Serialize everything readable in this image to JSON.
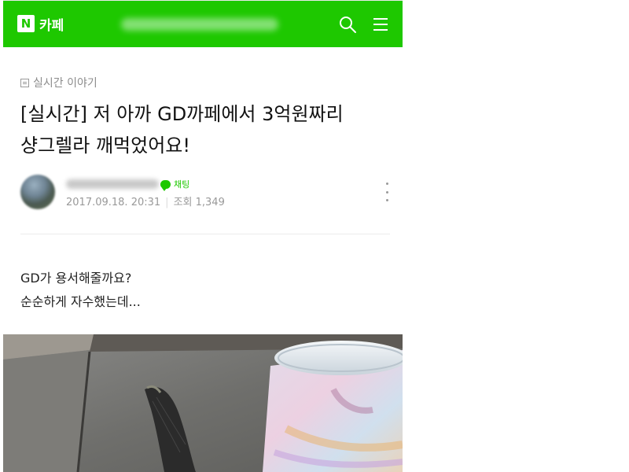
{
  "header": {
    "logo_letter": "N",
    "app_name": "카페",
    "brand_color": "#1ec800",
    "cafe_name_blurred": "",
    "search_icon": "search-icon",
    "menu_icon": "hamburger-menu-icon"
  },
  "article": {
    "category": "실시간 이야기",
    "title": "[실시간] 저 아까 GD까페에서 3억원짜리 샹그렐라 깨먹었어요!",
    "author": {
      "name_blurred": "",
      "chat_label": "채팅",
      "date": "2017.09.18. 20:31",
      "views_label": "조회",
      "views": "1,349"
    },
    "more_icon": "more-vertical-icon",
    "body_lines": [
      "GD가 용서해줄까요?",
      "순순하게 자수했는데..."
    ],
    "photo_description_icon": "photo"
  }
}
